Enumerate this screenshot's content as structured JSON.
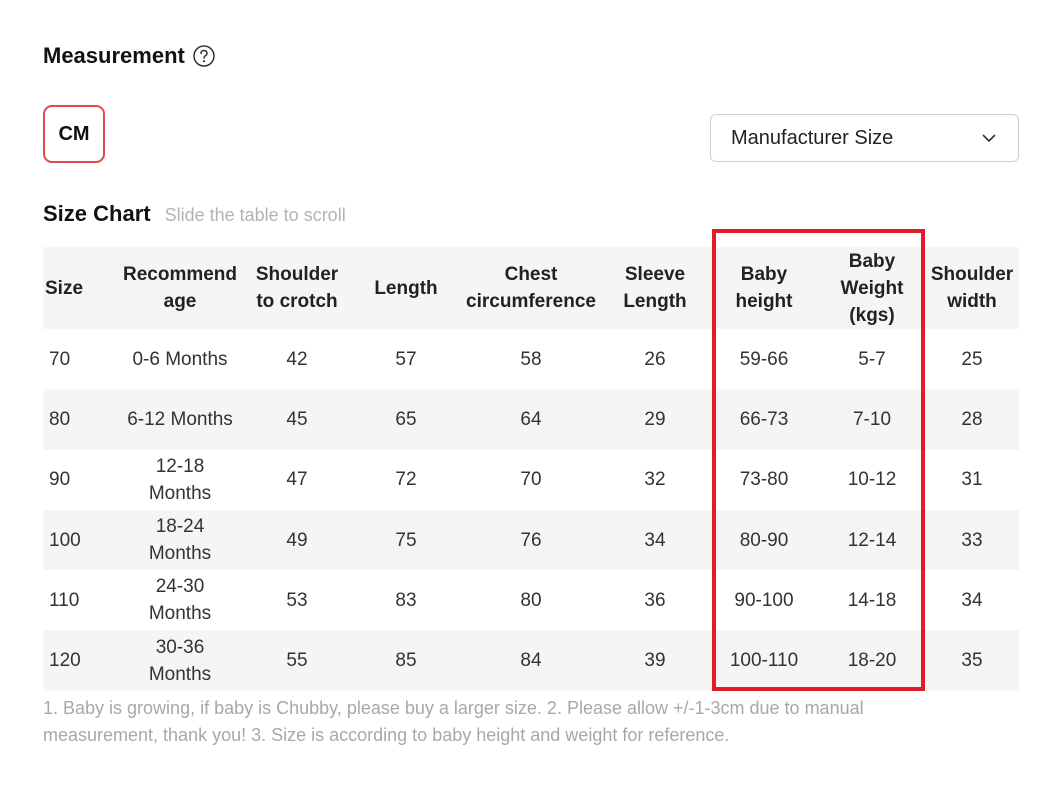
{
  "header": {
    "title": "Measurement"
  },
  "unit_button": {
    "label": "CM"
  },
  "size_select": {
    "value": "Manufacturer Size"
  },
  "chart": {
    "title": "Size Chart",
    "hint": "Slide the table to scroll"
  },
  "table": {
    "headers": [
      "Size",
      "Recommend\nage",
      "Shoulder\nto crotch",
      "Length",
      "Chest\ncircumference",
      "Sleeve\nLength",
      "Baby\nheight",
      "Baby\nWeight\n(kgs)",
      "Shoulder\nwidth"
    ],
    "rows": [
      [
        "70",
        "0-6 Months",
        "42",
        "57",
        "58",
        "26",
        "59-66",
        "5-7",
        "25"
      ],
      [
        "80",
        "6-12 Months",
        "45",
        "65",
        "64",
        "29",
        "66-73",
        "7-10",
        "28"
      ],
      [
        "90",
        "12-18\nMonths",
        "47",
        "72",
        "70",
        "32",
        "73-80",
        "10-12",
        "31"
      ],
      [
        "100",
        "18-24\nMonths",
        "49",
        "75",
        "76",
        "34",
        "80-90",
        "12-14",
        "33"
      ],
      [
        "110",
        "24-30\nMonths",
        "53",
        "83",
        "80",
        "36",
        "90-100",
        "14-18",
        "34"
      ],
      [
        "120",
        "30-36\nMonths",
        "55",
        "85",
        "84",
        "39",
        "100-110",
        "18-20",
        "35"
      ]
    ]
  },
  "note": "1. Baby is growing, if baby is Chubby, please buy a larger size. 2. Please allow +/-1-3cm due to manual measurement, thank you! 3. Size is according to baby height and weight for reference.",
  "colors": {
    "highlight": "#e01e2b",
    "unit_border": "#e04a4a",
    "row_alt": "#f5f5f5"
  }
}
